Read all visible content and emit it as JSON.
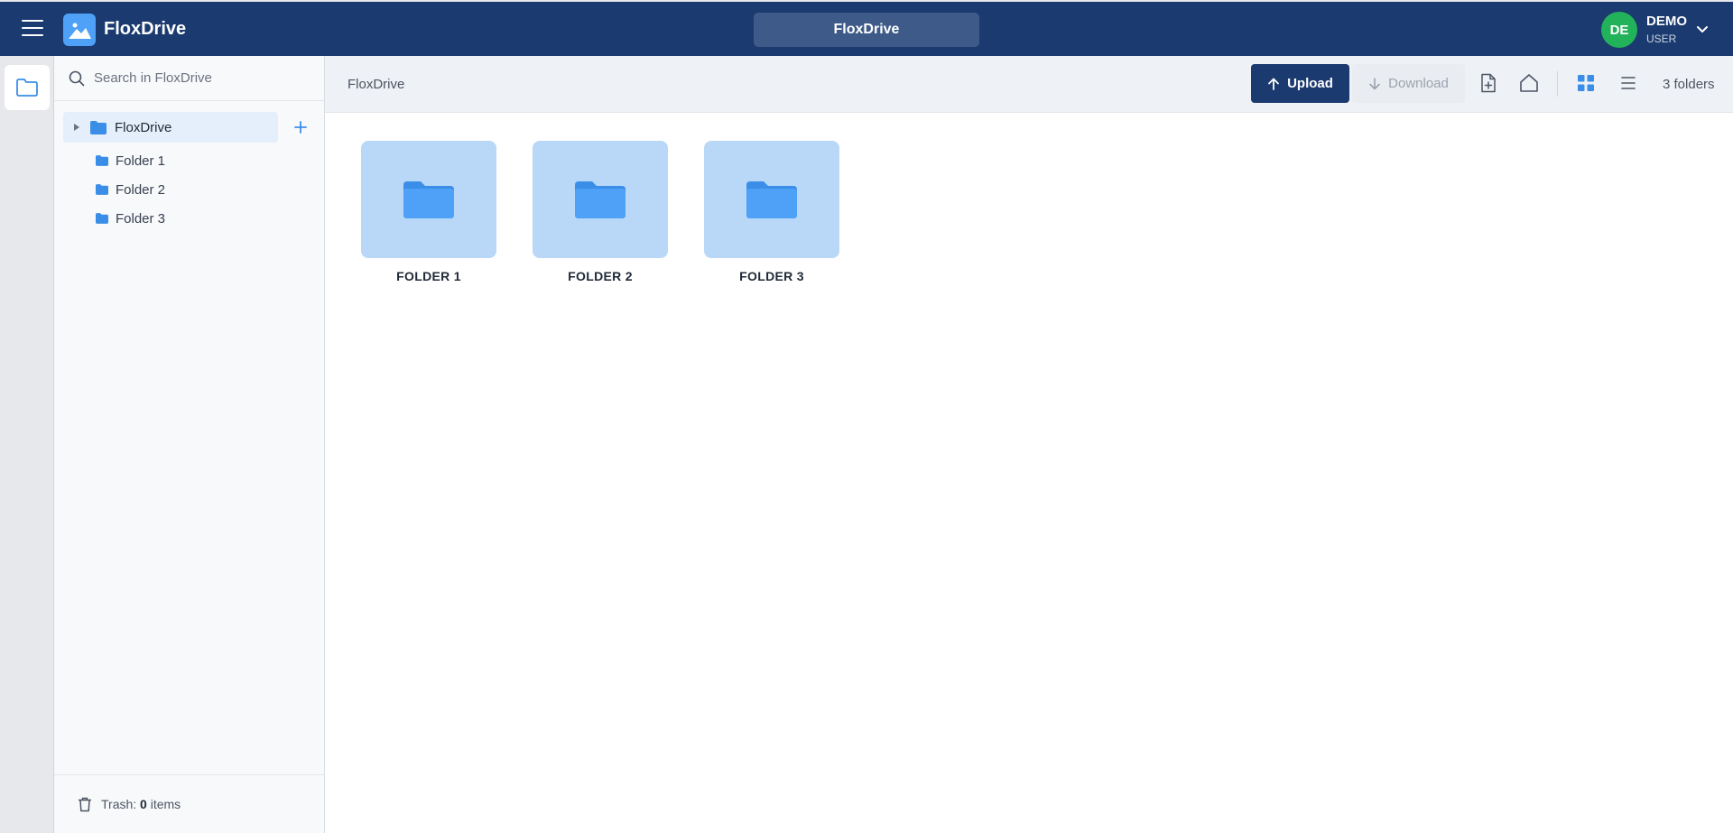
{
  "header": {
    "app_name": "FloxDrive",
    "center_title": "FloxDrive",
    "user": {
      "initials": "DE",
      "name": "DEMO",
      "role": "USER"
    }
  },
  "sidebar": {
    "search_placeholder": "Search in FloxDrive",
    "tree": {
      "root_label": "FloxDrive",
      "children": [
        "Folder 1",
        "Folder 2",
        "Folder 3"
      ]
    },
    "trash": {
      "prefix": "Trash:",
      "count": "0",
      "suffix": "items"
    }
  },
  "toolbar": {
    "breadcrumb": "FloxDrive",
    "upload_label": "Upload",
    "download_label": "Download",
    "item_count": "3 folders"
  },
  "content": {
    "folders": [
      "FOLDER 1",
      "FOLDER 2",
      "FOLDER 3"
    ]
  },
  "colors": {
    "header_bg": "#1b3a6f",
    "accent": "#4ea1f7",
    "avatar": "#22b35a",
    "tile_bg": "#b9d8f7"
  },
  "icons": [
    "menu-icon",
    "mountain-logo-icon",
    "chevron-down-icon",
    "folder-icon",
    "search-icon",
    "plus-icon",
    "trash-icon",
    "arrow-up-icon",
    "arrow-down-icon",
    "new-file-icon",
    "home-icon",
    "grid-view-icon",
    "list-view-icon"
  ]
}
